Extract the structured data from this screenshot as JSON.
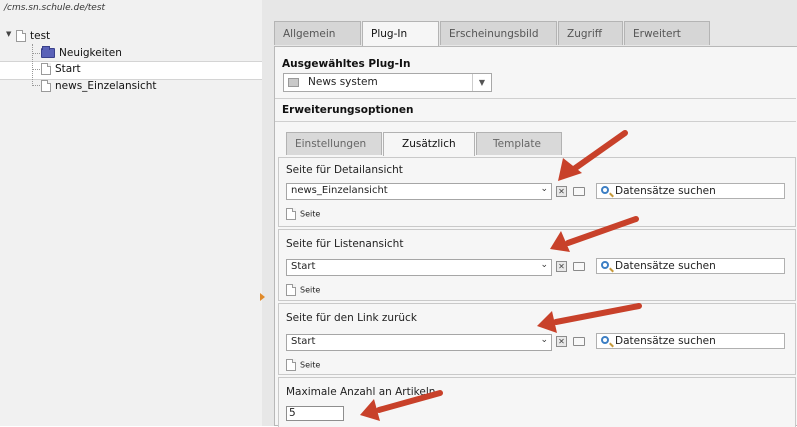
{
  "tree": {
    "path": "/cms.sn.schule.de/test",
    "root_label": "test",
    "items": [
      {
        "label": "Neuigkeiten",
        "type": "folder"
      },
      {
        "label": "Start",
        "type": "page"
      },
      {
        "label": "news_Einzelansicht",
        "type": "page"
      }
    ]
  },
  "tabs": [
    "Allgemein",
    "Plug-In",
    "Erscheinungsbild",
    "Zugriff",
    "Erweitert"
  ],
  "active_tab": "Plug-In",
  "plugin": {
    "section_label": "Ausgewähltes Plug-In",
    "selected": "News system"
  },
  "extension": {
    "section_label": "Erweiterungsoptionen",
    "subtabs": [
      "Einstellungen",
      "Zusätzlich",
      "Template"
    ],
    "active_subtab": "Zusätzlich"
  },
  "fields": [
    {
      "label": "Seite für Detailansicht",
      "value": "news_Einzelansicht",
      "search": "Datensätze suchen",
      "type_label": "Seite"
    },
    {
      "label": "Seite für Listenansicht",
      "value": "Start",
      "search": "Datensätze suchen",
      "type_label": "Seite"
    },
    {
      "label": "Seite für den Link zurück",
      "value": "Start",
      "search": "Datensätze suchen",
      "type_label": "Seite"
    }
  ],
  "max_articles": {
    "label": "Maximale Anzahl an Artikeln",
    "value": "5"
  },
  "colors": {
    "arrow": "#c8412a",
    "folder": "#5a62b8"
  }
}
